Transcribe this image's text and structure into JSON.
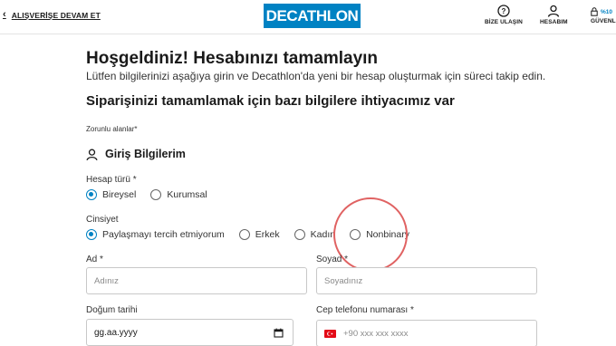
{
  "header": {
    "back_label": "ALIŞVERİŞE DEVAM ET",
    "logo_text": "DECATHLON",
    "contact_label": "BİZE ULAŞIN",
    "account_label": "HESABIM",
    "secure_percent": "%10",
    "secure_label": "GÜVENL"
  },
  "page": {
    "title": "Hoşgeldiniz! Hesabınızı tamamlayın",
    "subtitle": "Lütfen bilgilerinizi aşağıya girin ve Decathlon'da yeni bir hesap oluşturmak için süreci takip edin.",
    "section_title": "Siparişinizi tamamlamak için bazı bilgilere ihtiyacımız var",
    "required_note": "Zorunlu alanlar*",
    "login_section": "Giriş Bilgilerim"
  },
  "account_type": {
    "label": "Hesap türü *",
    "options": [
      {
        "label": "Bireysel",
        "selected": true
      },
      {
        "label": "Kurumsal",
        "selected": false
      }
    ]
  },
  "gender": {
    "label": "Cinsiyet",
    "options": [
      {
        "label": "Paylaşmayı tercih etmiyorum",
        "selected": true
      },
      {
        "label": "Erkek",
        "selected": false
      },
      {
        "label": "Kadın",
        "selected": false
      },
      {
        "label": "Nonbinary",
        "selected": false
      }
    ]
  },
  "fields": {
    "first_name": {
      "label": "Ad *",
      "placeholder": "Adınız"
    },
    "last_name": {
      "label": "Soyad *",
      "placeholder": "Soyadınız"
    },
    "birth_date": {
      "label": "Doğum tarihi",
      "value": "gg.aa.yyyy"
    },
    "phone": {
      "label": "Cep telefonu numarası *",
      "placeholder": "+90 xxx xxx xxxx"
    }
  },
  "colors": {
    "brand": "#0082c3",
    "highlight": "#e06262"
  }
}
